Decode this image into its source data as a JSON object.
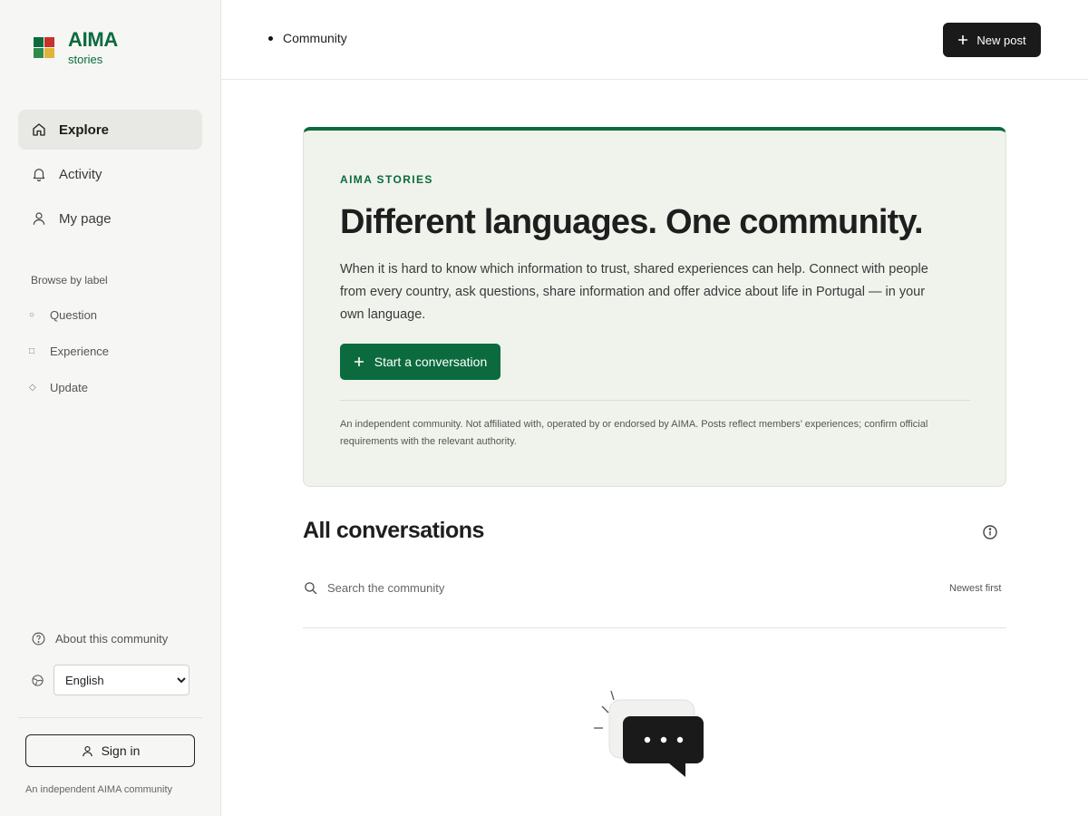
{
  "brand": {
    "title": "AIMA",
    "subtitle": "stories",
    "logo_colors": [
      "#0b6b3e",
      "#c8312b",
      "#e0b43a",
      "#2e8a4d"
    ]
  },
  "nav": {
    "items": [
      {
        "label": "Explore",
        "icon": "home-icon",
        "active": true
      },
      {
        "label": "Activity",
        "icon": "bell-icon",
        "active": false
      },
      {
        "label": "My page",
        "icon": "user-icon",
        "active": false
      }
    ]
  },
  "labels": {
    "title": "Browse by label",
    "items": [
      {
        "label": "Question",
        "glyph": "○"
      },
      {
        "label": "Experience",
        "glyph": "□"
      },
      {
        "label": "Update",
        "glyph": "◇"
      }
    ]
  },
  "sidebar_footer": {
    "about": "About this community",
    "language": {
      "selected": "English"
    },
    "signin": "Sign in",
    "note": "An independent AIMA community"
  },
  "topbar": {
    "breadcrumb": "Community",
    "new_post": "New post"
  },
  "hero": {
    "eyebrow": "AIMA STORIES",
    "title": "Different languages. One community.",
    "body": "When it is hard to know which information to trust, shared experiences can help. Connect with people from every country, ask questions, share information and offer advice about life in Portugal — in your own language.",
    "cta": "Start a conversation",
    "disclaimer": "An independent community. Not affiliated with, operated by or endorsed by AIMA. Posts reflect members’ experiences; confirm official requirements with the relevant authority."
  },
  "conversations": {
    "title": "All conversations",
    "search_placeholder": "Search the community",
    "sort": "Newest first"
  },
  "colors": {
    "accent": "#0b6b3e",
    "dark": "#1a1a1a",
    "hero_bg": "#f0f3ec",
    "sidebar_bg": "#f6f6f4"
  }
}
